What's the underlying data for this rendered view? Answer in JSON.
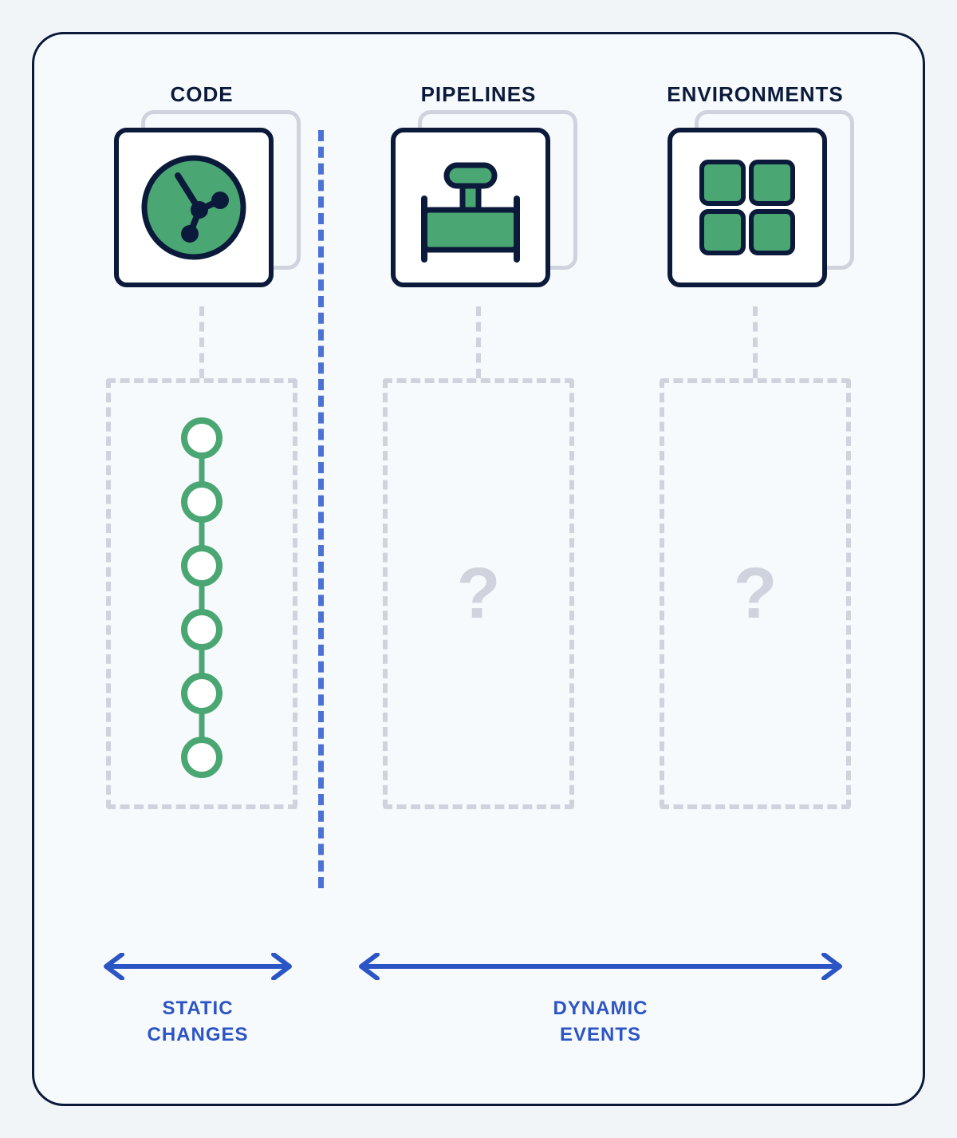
{
  "columns": {
    "code": {
      "label": "CODE"
    },
    "pipelines": {
      "label": "PIPELINES",
      "placeholder": "?"
    },
    "environments": {
      "label": "ENVIRONMENTS",
      "placeholder": "?"
    }
  },
  "sections": {
    "static": {
      "label": "STATIC\nCHANGES"
    },
    "dynamic": {
      "label": "DYNAMIC\nEVENTS"
    }
  },
  "colors": {
    "navy": "#0b1a3a",
    "green": "#4aa773",
    "grey": "#cfd3dd",
    "blue": "#2b54c5"
  }
}
